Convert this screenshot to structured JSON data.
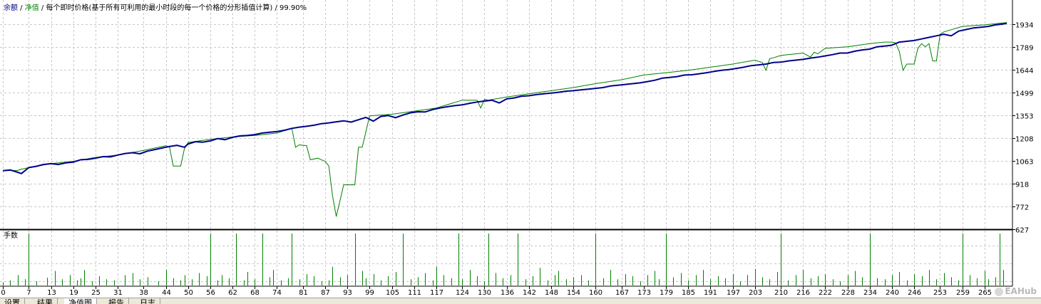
{
  "header": {
    "legend_balance": "余额",
    "sep1": " / ",
    "legend_equity": "净值",
    "sep2": " / ",
    "model_text": "每个即时价格(基于所有可利用的最小时段的每一个价格的分形插值计算)",
    "sep3": " / ",
    "quality": "99.90%"
  },
  "lower_panel_title": "手数",
  "tabs": [
    {
      "label": "设置"
    },
    {
      "label": "结果"
    },
    {
      "label": "净值图"
    },
    {
      "label": "报告"
    },
    {
      "label": "日志"
    }
  ],
  "watermark": "EAHub",
  "colors": {
    "balance": "#00008b",
    "equity": "#008000",
    "lots": "#008000",
    "grid": "#c8c8c8",
    "legend_text": "#00008b"
  },
  "chart_data": [
    {
      "type": "line",
      "title": "",
      "xlabel": "",
      "ylabel": "",
      "ylim": [
        627,
        1990
      ],
      "y_ticks": [
        1934,
        1789,
        1644,
        1499,
        1353,
        1208,
        1063,
        918,
        772,
        627
      ],
      "x_ticks": [
        0,
        7,
        13,
        19,
        25,
        31,
        38,
        44,
        50,
        56,
        62,
        68,
        74,
        81,
        87,
        93,
        99,
        105,
        111,
        117,
        124,
        130,
        136,
        142,
        148,
        154,
        160,
        167,
        173,
        179,
        185,
        191,
        197,
        203,
        210,
        216,
        222,
        228,
        234,
        240,
        246,
        253,
        259,
        265
      ],
      "xlim": [
        0,
        271
      ],
      "grid": true,
      "series": [
        {
          "name": "余额",
          "x": [
            0,
            2,
            4,
            5,
            7,
            9,
            11,
            13,
            15,
            17,
            19,
            21,
            23,
            25,
            27,
            29,
            31,
            33,
            35,
            37,
            39,
            41,
            43,
            45,
            47,
            49,
            50,
            52,
            54,
            56,
            58,
            60,
            62,
            64,
            66,
            68,
            70,
            72,
            74,
            76,
            78,
            80,
            82,
            84,
            86,
            88,
            90,
            92,
            94,
            96,
            98,
            100,
            102,
            104,
            106,
            108,
            110,
            112,
            114,
            116,
            118,
            120,
            122,
            124,
            126,
            128,
            130,
            132,
            134,
            136,
            138,
            140,
            142,
            144,
            146,
            148,
            150,
            152,
            154,
            156,
            158,
            160,
            162,
            164,
            166,
            168,
            170,
            172,
            174,
            176,
            178,
            180,
            182,
            184,
            186,
            188,
            190,
            192,
            194,
            196,
            198,
            200,
            202,
            204,
            206,
            208,
            210,
            212,
            214,
            216,
            218,
            220,
            222,
            224,
            226,
            228,
            230,
            232,
            234,
            236,
            238,
            240,
            242,
            244,
            246,
            248,
            250,
            252,
            254,
            256,
            258,
            260,
            262,
            264,
            266,
            268,
            270,
            271
          ],
          "values": [
            1000,
            1005,
            990,
            982,
            1020,
            1028,
            1040,
            1045,
            1040,
            1050,
            1055,
            1070,
            1072,
            1080,
            1090,
            1088,
            1100,
            1110,
            1115,
            1108,
            1125,
            1135,
            1145,
            1155,
            1162,
            1150,
            1170,
            1185,
            1182,
            1190,
            1205,
            1198,
            1213,
            1222,
            1225,
            1230,
            1240,
            1245,
            1250,
            1258,
            1270,
            1278,
            1283,
            1290,
            1300,
            1305,
            1312,
            1318,
            1310,
            1325,
            1340,
            1316,
            1346,
            1352,
            1338,
            1355,
            1369,
            1376,
            1375,
            1390,
            1400,
            1408,
            1415,
            1420,
            1430,
            1438,
            1444,
            1450,
            1432,
            1458,
            1464,
            1475,
            1478,
            1485,
            1490,
            1495,
            1500,
            1507,
            1510,
            1515,
            1520,
            1525,
            1530,
            1540,
            1545,
            1550,
            1555,
            1560,
            1568,
            1577,
            1590,
            1595,
            1600,
            1610,
            1612,
            1618,
            1625,
            1633,
            1640,
            1645,
            1652,
            1660,
            1670,
            1675,
            1680,
            1690,
            1692,
            1700,
            1705,
            1710,
            1718,
            1724,
            1732,
            1740,
            1750,
            1750,
            1762,
            1770,
            1775,
            1790,
            1794,
            1800,
            1820,
            1825,
            1830,
            1840,
            1850,
            1860,
            1870,
            1860,
            1890,
            1900,
            1910,
            1915,
            1920,
            1930,
            1935,
            1940
          ]
        },
        {
          "name": "净值",
          "x": [
            0,
            4,
            5,
            7,
            13,
            19,
            25,
            31,
            38,
            44,
            45,
            46,
            48,
            49,
            50,
            56,
            62,
            68,
            74,
            78,
            79,
            80,
            82,
            83,
            85,
            87,
            88,
            89,
            90,
            92,
            94,
            95,
            96,
            97,
            99,
            105,
            111,
            117,
            124,
            128,
            129,
            130,
            131,
            136,
            142,
            148,
            154,
            160,
            167,
            173,
            179,
            185,
            191,
            197,
            203,
            205,
            206,
            207,
            208,
            210,
            216,
            218,
            219,
            220,
            222,
            228,
            234,
            238,
            240,
            241,
            242,
            243,
            244,
            246,
            247,
            248,
            249,
            250,
            251,
            252,
            253,
            254,
            259,
            265,
            271
          ],
          "values": [
            1000,
            1002,
            1010,
            1020,
            1045,
            1060,
            1085,
            1100,
            1130,
            1160,
            1150,
            1030,
            1030,
            1140,
            1180,
            1200,
            1215,
            1225,
            1240,
            1270,
            1150,
            1165,
            1160,
            1070,
            1080,
            1060,
            1030,
            840,
            708,
            910,
            910,
            910,
            1150,
            1150,
            1350,
            1360,
            1380,
            1400,
            1450,
            1450,
            1400,
            1455,
            1450,
            1470,
            1490,
            1510,
            1530,
            1555,
            1580,
            1610,
            1625,
            1640,
            1660,
            1680,
            1705,
            1690,
            1640,
            1715,
            1720,
            1735,
            1750,
            1725,
            1755,
            1745,
            1780,
            1790,
            1810,
            1820,
            1820,
            1815,
            1760,
            1640,
            1680,
            1680,
            1780,
            1810,
            1790,
            1810,
            1700,
            1700,
            1870,
            1885,
            1920,
            1930,
            1945
          ]
        }
      ]
    },
    {
      "type": "bar",
      "title": "手数",
      "ylim": [
        0,
        1
      ],
      "x": [
        0,
        2,
        4,
        6,
        7,
        9,
        12,
        14,
        16,
        18,
        20,
        21,
        22,
        24,
        26,
        28,
        30,
        33,
        35,
        37,
        39,
        42,
        44,
        46,
        48,
        49,
        51,
        53,
        55,
        56,
        58,
        59,
        61,
        63,
        65,
        66,
        68,
        70,
        72,
        73,
        75,
        77,
        78,
        80,
        82,
        84,
        86,
        88,
        89,
        91,
        93,
        95,
        97,
        98,
        100,
        102,
        104,
        106,
        108,
        110,
        112,
        114,
        116,
        117,
        119,
        121,
        123,
        124,
        126,
        128,
        130,
        131,
        133,
        135,
        137,
        139,
        141,
        143,
        145,
        147,
        149,
        150,
        152,
        154,
        156,
        158,
        160,
        162,
        164,
        166,
        168,
        170,
        172,
        174,
        176,
        177,
        179,
        181,
        183,
        185,
        187,
        189,
        191,
        193,
        195,
        197,
        199,
        201,
        203,
        205,
        207,
        209,
        210,
        212,
        214,
        216,
        218,
        220,
        222,
        224,
        226,
        228,
        230,
        232,
        234,
        236,
        238,
        240,
        242,
        244,
        246,
        248,
        250,
        252,
        254,
        256,
        258,
        259,
        261,
        263,
        265,
        266,
        268,
        269,
        270
      ],
      "values": [
        0.06,
        0.1,
        0.2,
        0.12,
        1.0,
        0.08,
        0.15,
        0.28,
        0.12,
        0.2,
        0.1,
        0.14,
        0.3,
        0.08,
        0.18,
        0.12,
        0.1,
        0.2,
        0.24,
        0.12,
        0.16,
        0.08,
        0.3,
        0.14,
        0.1,
        0.2,
        0.12,
        0.24,
        0.18,
        1.0,
        0.1,
        0.2,
        0.14,
        1.0,
        0.1,
        0.26,
        0.12,
        1.0,
        0.16,
        0.3,
        0.1,
        0.14,
        1.0,
        0.12,
        0.22,
        0.18,
        0.08,
        0.1,
        0.36,
        0.16,
        0.2,
        1.0,
        0.28,
        0.14,
        0.22,
        0.1,
        0.18,
        0.26,
        1.0,
        0.12,
        0.16,
        0.24,
        0.1,
        0.36,
        0.2,
        0.14,
        1.0,
        0.12,
        0.3,
        0.18,
        0.08,
        1.0,
        0.24,
        0.14,
        0.2,
        1.0,
        0.12,
        0.18,
        0.34,
        0.1,
        0.2,
        0.28,
        0.12,
        0.16,
        0.2,
        0.1,
        1.0,
        0.14,
        0.3,
        0.12,
        0.22,
        0.18,
        0.08,
        0.2,
        0.28,
        0.12,
        1.0,
        0.16,
        0.24,
        0.1,
        0.2,
        0.3,
        0.12,
        0.18,
        0.14,
        0.22,
        0.08,
        0.2,
        0.32,
        0.16,
        0.12,
        0.26,
        1.0,
        0.1,
        0.2,
        0.3,
        0.14,
        0.18,
        0.22,
        0.12,
        0.08,
        0.2,
        0.28,
        0.16,
        1.0,
        0.14,
        0.12,
        0.2,
        0.26,
        0.1,
        0.22,
        0.18,
        0.3,
        0.12,
        0.24,
        0.16,
        0.1,
        1.0,
        0.2,
        0.14,
        0.28,
        0.12,
        0.16,
        1.0,
        0.3
      ]
    }
  ]
}
